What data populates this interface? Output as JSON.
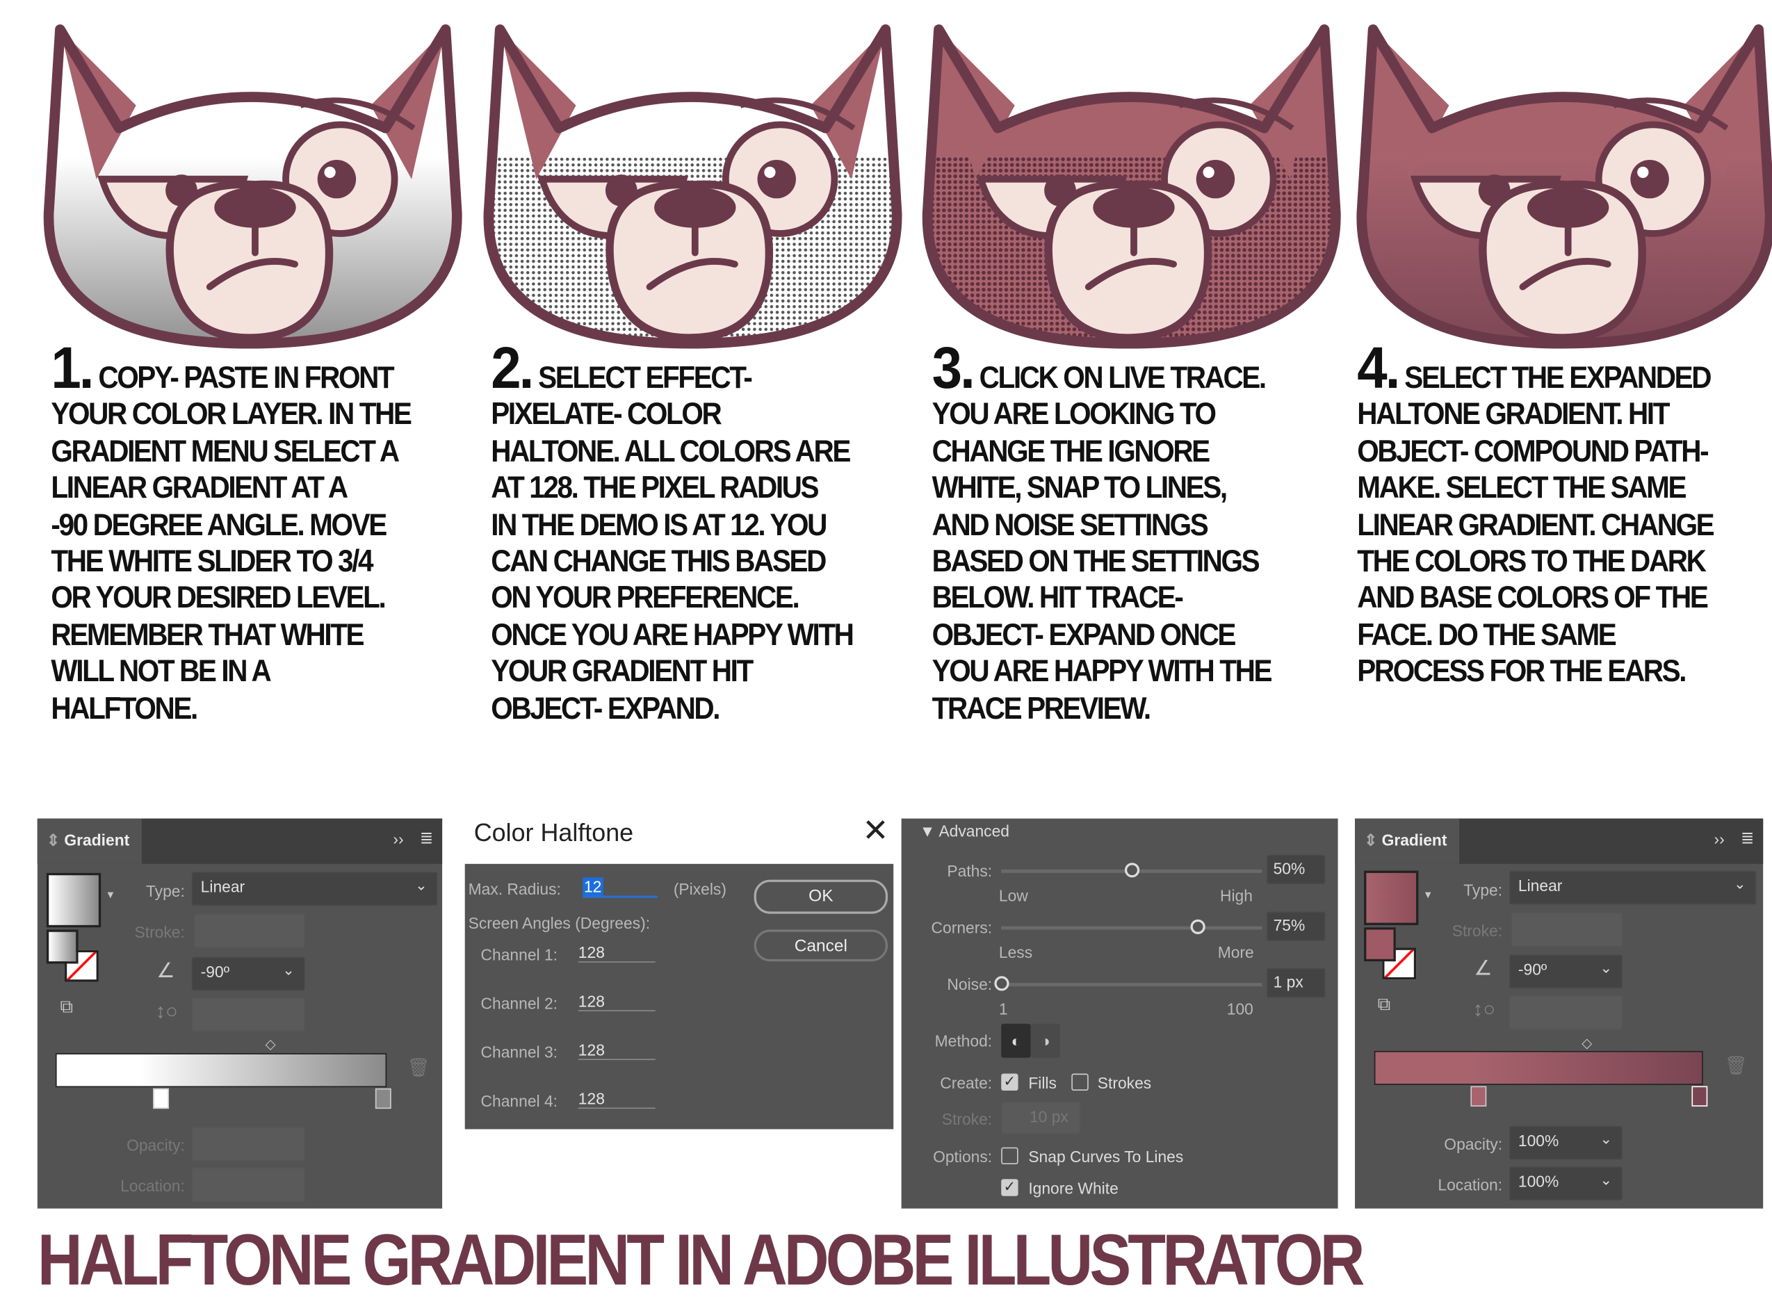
{
  "colors": {
    "outline": "#6b3a4a",
    "rose": "#a8626b",
    "rose_dark": "#7a4452",
    "eye": "#f3e3dc",
    "panel": "#535353",
    "title": "#6e3849"
  },
  "steps": [
    {
      "num": "1.",
      "lines": [
        "COPY- PASTE IN FRONT",
        "YOUR COLOR LAYER. IN THE",
        "GRADIENT MENU SELECT A",
        "LINEAR GRADIENT AT A",
        "-90 DEGREE ANGLE. MOVE",
        "THE WHITE SLIDER TO 3/4",
        "OR YOUR DESIRED LEVEL.",
        "REMEMBER THAT WHITE",
        "WILL NOT BE IN A",
        "HALFTONE."
      ]
    },
    {
      "num": "2.",
      "lines": [
        "SELECT EFFECT-",
        "PIXELATE- COLOR",
        "HALTONE. ALL COLORS ARE",
        "AT 128. THE PIXEL RADIUS",
        "IN THE DEMO IS AT 12. YOU",
        "CAN CHANGE THIS BASED",
        "ON YOUR PREFERENCE.",
        "ONCE YOU ARE HAPPY WITH",
        "YOUR GRADIENT HIT",
        "OBJECT- EXPAND."
      ]
    },
    {
      "num": "3.",
      "lines": [
        "CLICK ON LIVE TRACE.",
        "YOU ARE LOOKING TO",
        "CHANGE THE IGNORE",
        "WHITE, SNAP TO LINES,",
        "AND NOISE SETTINGS",
        "BASED ON THE SETTINGS",
        "BELOW. HIT TRACE-",
        "OBJECT- EXPAND ONCE",
        "YOU ARE HAPPY WITH THE",
        "TRACE PREVIEW."
      ]
    },
    {
      "num": "4.",
      "lines": [
        "SELECT THE EXPANDED",
        "HALTONE GRADIENT. HIT",
        "OBJECT- COMPOUND PATH-",
        "MAKE. SELECT THE SAME",
        "LINEAR GRADIENT. CHANGE",
        "THE COLORS TO THE DARK",
        "AND BASE COLORS OF THE",
        "FACE. DO THE SAME",
        "PROCESS FOR THE EARS."
      ]
    }
  ],
  "gradient1": {
    "tab": "Gradient",
    "type_label": "Type:",
    "type_value": "Linear",
    "stroke_label": "Stroke:",
    "angle_value": "-90º",
    "opacity_label": "Opacity:",
    "location_label": "Location:",
    "stops": [
      "#ffffff",
      "#8a8a8a"
    ]
  },
  "halftone": {
    "title": "Color Halftone",
    "max_radius_label": "Max. Radius:",
    "max_radius_value": "12",
    "units": "(Pixels)",
    "angles_label": "Screen Angles (Degrees):",
    "channels": [
      {
        "label": "Channel 1:",
        "value": "128"
      },
      {
        "label": "Channel 2:",
        "value": "128"
      },
      {
        "label": "Channel 3:",
        "value": "128"
      },
      {
        "label": "Channel 4:",
        "value": "128"
      }
    ],
    "ok": "OK",
    "cancel": "Cancel"
  },
  "trace": {
    "section": "Advanced",
    "paths_label": "Paths:",
    "paths_value": "50%",
    "paths_pct": 50,
    "low": "Low",
    "high": "High",
    "corners_label": "Corners:",
    "corners_value": "75%",
    "corners_pct": 75,
    "less": "Less",
    "more": "More",
    "noise_label": "Noise:",
    "noise_value": "1 px",
    "noise_pct": 0,
    "noise_min": "1",
    "noise_max": "100",
    "method_label": "Method:",
    "create_label": "Create:",
    "fills": "Fills",
    "fills_checked": true,
    "strokes": "Strokes",
    "strokes_checked": false,
    "stroke_label": "Stroke:",
    "stroke_value": "10 px",
    "options_label": "Options:",
    "snap": "Snap Curves To Lines",
    "snap_checked": false,
    "ignore_white": "Ignore White",
    "ignore_white_checked": true
  },
  "gradient4": {
    "tab": "Gradient",
    "type_label": "Type:",
    "type_value": "Linear",
    "stroke_label": "Stroke:",
    "angle_value": "-90º",
    "opacity_label": "Opacity:",
    "opacity_value": "100%",
    "location_label": "Location:",
    "location_value": "100%",
    "stops": [
      "#a8636d",
      "#7a4553"
    ]
  },
  "title": "HALFTONE GRADIENT IN ADOBE ILLUSTRATOR"
}
